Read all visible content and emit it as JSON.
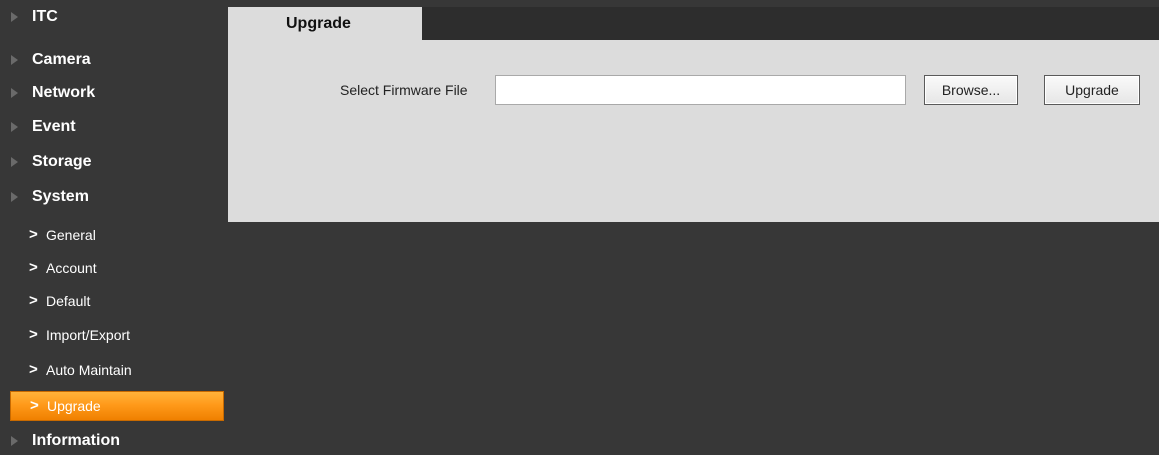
{
  "sidebar": {
    "menu": [
      {
        "label": "ITC"
      },
      {
        "label": "Camera"
      },
      {
        "label": "Network"
      },
      {
        "label": "Event"
      },
      {
        "label": "Storage"
      },
      {
        "label": "System"
      },
      {
        "label": "Information"
      }
    ],
    "system_submenu": [
      {
        "label": "General"
      },
      {
        "label": "Account"
      },
      {
        "label": "Default"
      },
      {
        "label": "Import/Export"
      },
      {
        "label": "Auto Maintain"
      },
      {
        "label": "Upgrade",
        "active": true
      }
    ],
    "menu_arrow_icon": "triangle-right-icon",
    "submenu_chevron_glyph": ">"
  },
  "main": {
    "tab": {
      "label": "Upgrade"
    },
    "form": {
      "firmware_label": "Select Firmware File",
      "firmware_value": "",
      "browse_label": "Browse...",
      "upgrade_label": "Upgrade"
    }
  },
  "colors": {
    "background": "#373737",
    "panel": "#dcdcdc",
    "active_item": "#ff9a1a"
  }
}
